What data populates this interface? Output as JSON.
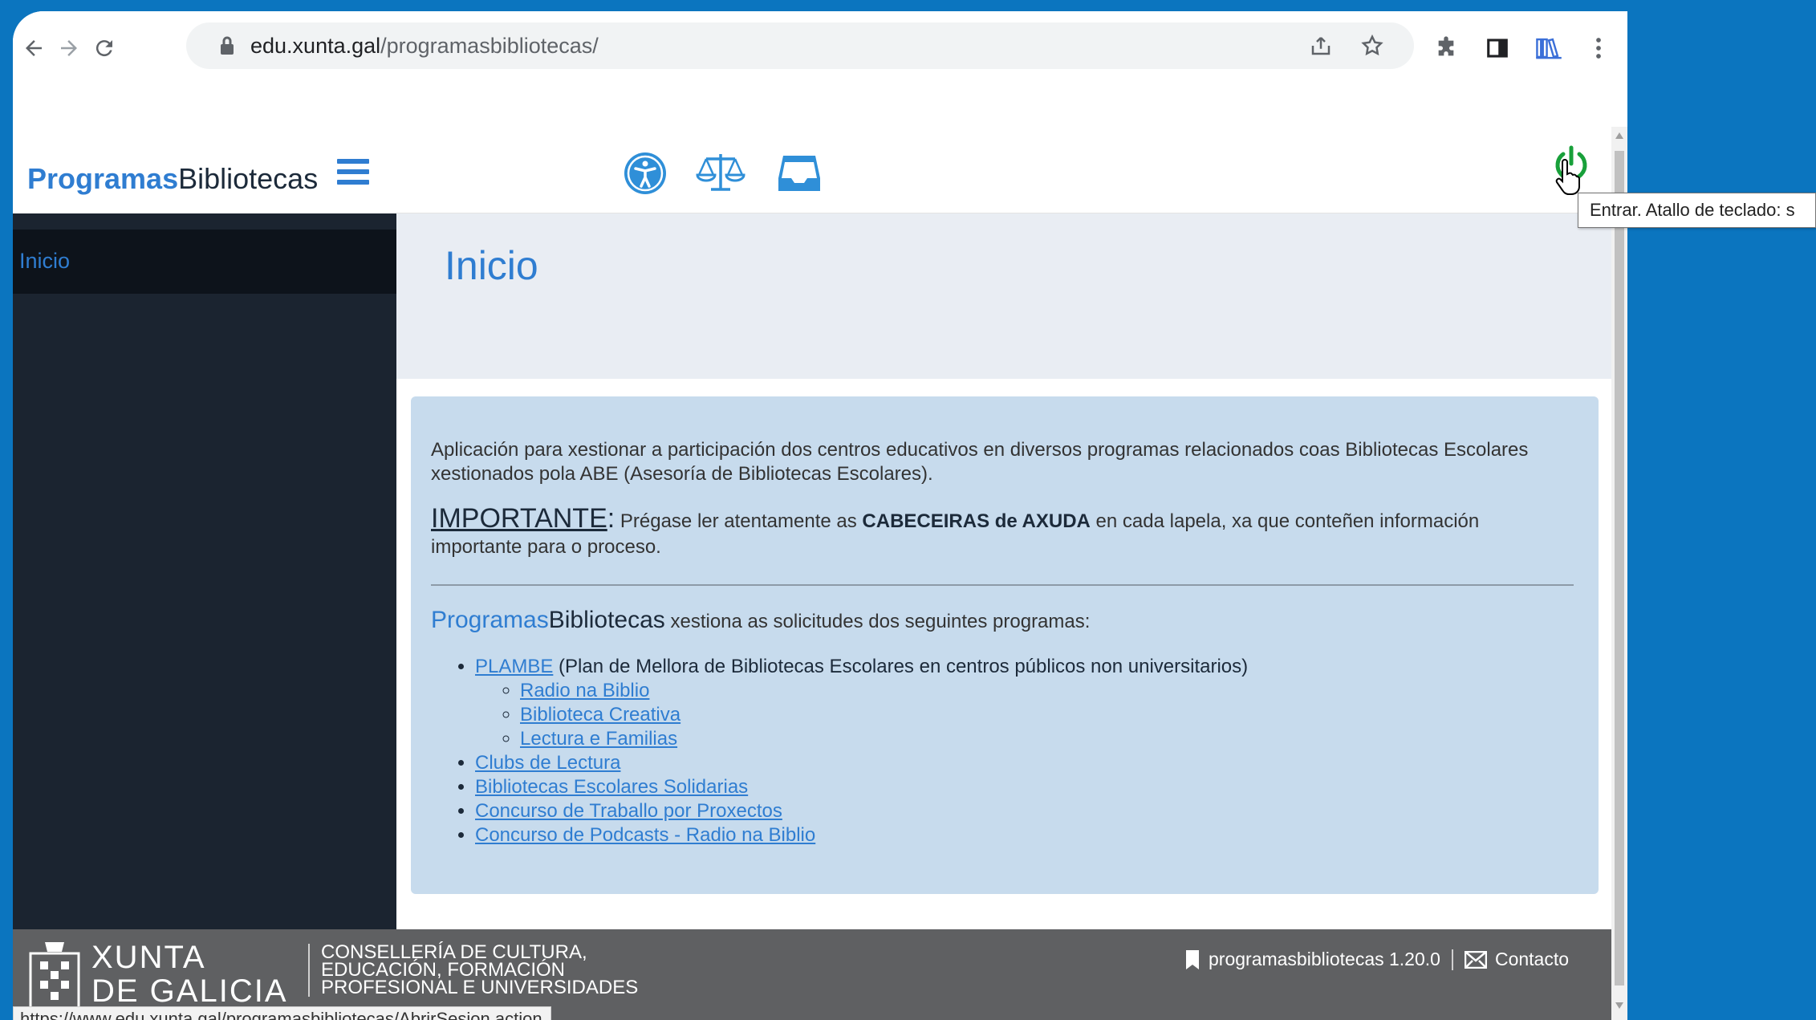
{
  "browser": {
    "url_host": "edu.xunta.gal",
    "url_path": "/programasbibliotecas/",
    "status_url": "https://www.edu.xunta.gal/programasbibliotecas/AbrirSesion.action"
  },
  "sidebar": {
    "brand_part1": "Programas",
    "brand_part2": "Bibliotecas",
    "items": [
      {
        "label": "Inicio"
      }
    ]
  },
  "topbar": {
    "tooltip": "Entrar. Atallo de teclado: s"
  },
  "main": {
    "title": "Inicio",
    "intro": "Aplicación para xestionar a participación dos centros educativos en diversos programas relacionados coas Bibliotecas Escolares xestionados pola ABE (Asesoría de Bibliotecas Escolares).",
    "important_label": "IMPORTANTE",
    "important_colon": ":",
    "important_pre": " Prégase ler atentamente as ",
    "important_bold": "CABECEIRAS de AXUDA",
    "important_post": " en cada lapela, xa que conteñen información importante para o proceso.",
    "lead_part1": "Programas",
    "lead_part2": "Bibliotecas",
    "lead_rest": " xestiona as solicitudes dos seguintes programas:",
    "programs": {
      "plambe_link": "PLAMBE",
      "plambe_desc": " (Plan de Mellora de Bibliotecas Escolares en centros públicos non universitarios)",
      "sub": [
        "Radio na Biblio",
        "Biblioteca Creativa",
        "Lectura e Familias"
      ],
      "others": [
        "Clubs de Lectura",
        "Bibliotecas Escolares Solidarias",
        "Concurso de Traballo por Proxectos",
        "Concurso de Podcasts - Radio na Biblio"
      ]
    }
  },
  "footer": {
    "xunta_line1": "XUNTA",
    "xunta_line2": "DE GALICIA",
    "cons_line1": "Consellería de Cultura,",
    "cons_line2": "Educación, Formación",
    "cons_line3": "Profesional e Universidades",
    "version": "programasbibliotecas 1.20.0",
    "contact": "Contacto"
  },
  "colors": {
    "accent": "#2f7dd1",
    "sidebar_bg": "#1b2430",
    "panel_bg": "#c7dbed",
    "footer_bg": "#5f6062",
    "power_green": "#18a03a"
  }
}
